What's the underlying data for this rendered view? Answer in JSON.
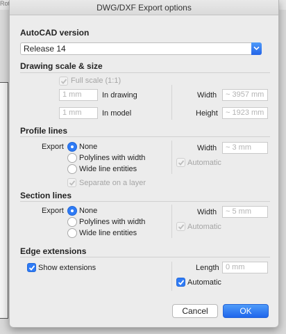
{
  "background": {
    "side_label": "Rota"
  },
  "dialog": {
    "title": "DWG/DXF Export options",
    "autocad": {
      "heading": "AutoCAD version",
      "selected": "Release 14"
    },
    "scale": {
      "heading": "Drawing scale & size",
      "full_scale_label": "Full scale (1:1)",
      "full_scale_checked": true,
      "in_drawing_placeholder": "1 mm",
      "in_drawing_label": "In drawing",
      "in_model_placeholder": "1 mm",
      "in_model_label": "In model",
      "width_label": "Width",
      "width_value": "~ 3957 mm",
      "height_label": "Height",
      "height_value": "~ 1923 mm"
    },
    "profile": {
      "heading": "Profile lines",
      "export_label": "Export",
      "options": [
        "None",
        "Polylines with width",
        "Wide line entities"
      ],
      "selected": "None",
      "separate_label": "Separate on a layer",
      "separate_checked": true,
      "width_label": "Width",
      "width_value": "~ 3 mm",
      "automatic_label": "Automatic",
      "automatic_checked": true
    },
    "section": {
      "heading": "Section lines",
      "export_label": "Export",
      "options": [
        "None",
        "Polylines with width",
        "Wide line entities"
      ],
      "selected": "None",
      "width_label": "Width",
      "width_value": "~ 5 mm",
      "automatic_label": "Automatic",
      "automatic_checked": true
    },
    "edge": {
      "heading": "Edge extensions",
      "show_label": "Show extensions",
      "show_checked": true,
      "length_label": "Length",
      "length_placeholder": "0 mm",
      "automatic_label": "Automatic",
      "automatic_checked": true
    },
    "buttons": {
      "cancel": "Cancel",
      "ok": "OK"
    },
    "colors": {
      "accent": "#2f7bf5",
      "disabled_text": "#a5a5a5"
    }
  }
}
